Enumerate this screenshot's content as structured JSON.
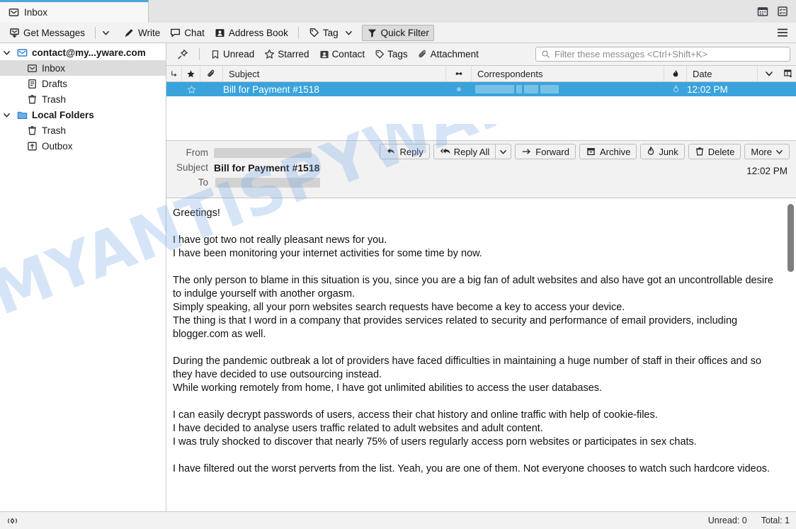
{
  "window": {
    "tab_label": "Inbox",
    "tab_icon": "inbox-mail-icon",
    "top_right_icons": [
      "calendar-icon",
      "tasks-icon"
    ],
    "app_menu_icon": "hamburger-menu-icon"
  },
  "toolbar": {
    "get_messages": "Get Messages",
    "get_messages_icon": "download-mail-icon",
    "write": "Write",
    "write_icon": "pencil-icon",
    "chat": "Chat",
    "chat_icon": "speech-bubble-icon",
    "address_book": "Address Book",
    "address_book_icon": "contact-card-icon",
    "tag": "Tag",
    "tag_icon": "tag-icon",
    "quick_filter": "Quick Filter",
    "quick_filter_icon": "funnel-icon",
    "quick_filter_active": true
  },
  "sidebar": {
    "accounts": [
      {
        "label": "contact@my...yware.com",
        "icon": "account-mail-icon",
        "expanded": true,
        "children": [
          {
            "label": "Inbox",
            "icon": "inbox-icon",
            "selected": true
          },
          {
            "label": "Drafts",
            "icon": "drafts-icon",
            "selected": false
          },
          {
            "label": "Trash",
            "icon": "trash-icon",
            "selected": false
          }
        ]
      },
      {
        "label": "Local Folders",
        "icon": "folder-icon",
        "expanded": true,
        "children": [
          {
            "label": "Trash",
            "icon": "trash-icon",
            "selected": false
          },
          {
            "label": "Outbox",
            "icon": "outbox-icon",
            "selected": false
          }
        ]
      }
    ]
  },
  "quick_filter": {
    "pin_icon": "pin-icon",
    "unread": "Unread",
    "unread_icon": "bookmark-icon",
    "starred": "Starred",
    "starred_icon": "star-icon",
    "contact": "Contact",
    "contact_icon": "contact-card-icon",
    "tags": "Tags",
    "tags_icon": "tag-icon",
    "attachment": "Attachment",
    "attachment_icon": "paperclip-icon",
    "search_placeholder": "Filter these messages <Ctrl+Shift+K>",
    "search_value": "",
    "search_icon": "magnifier-icon"
  },
  "message_list": {
    "columns": [
      {
        "label": "",
        "icon": "thread-icon"
      },
      {
        "label": "",
        "icon": "star-icon"
      },
      {
        "label": "",
        "icon": "paperclip-icon"
      },
      {
        "label": "Subject",
        "icon": ""
      },
      {
        "label": "",
        "icon": "unread-dot-icon"
      },
      {
        "label": "Correspondents",
        "icon": ""
      },
      {
        "label": "",
        "icon": "junk-icon"
      },
      {
        "label": "Date",
        "icon": ""
      },
      {
        "label": "",
        "icon": "sort-caret-icon"
      },
      {
        "label": "",
        "icon": "column-picker-icon"
      }
    ],
    "rows": [
      {
        "subject": "Bill for Payment #1518",
        "correspondents": "",
        "date": "12:02 PM",
        "selected": true,
        "starred": false
      }
    ]
  },
  "message_header": {
    "from_label": "From",
    "from_value": "",
    "subject_label": "Subject",
    "subject_value": "Bill for Payment #1518",
    "to_label": "To",
    "to_value": "",
    "time": "12:02 PM",
    "actions": [
      {
        "label": "Reply",
        "icon": "reply-icon"
      },
      {
        "label": "Reply All",
        "icon": "reply-all-icon",
        "has_caret": true
      },
      {
        "label": "Forward",
        "icon": "forward-arrow-icon"
      },
      {
        "label": "Archive",
        "icon": "archive-box-icon"
      },
      {
        "label": "Junk",
        "icon": "junk-flame-icon"
      },
      {
        "label": "Delete",
        "icon": "trash-icon"
      },
      {
        "label": "More",
        "icon": "",
        "has_caret": true
      }
    ]
  },
  "message_body": {
    "paragraphs": [
      "Greetings!",
      "I have got two not really pleasant news for you.\nI have been monitoring your internet activities for some time by now.",
      "The only person to blame in this situation is you, since you are a big fan of adult websites and also have got an uncontrollable desire to indulge yourself with another orgasm.\nSimply speaking, all your porn websites search requests have become a key to access your device.\nThe thing is that I word in a company that provides services related to security and performance of email providers, including blogger.com as well.",
      "During the pandemic outbreak a lot of providers have faced difficulties in maintaining a huge number of staff in their offices and so they have decided to use outsourcing instead.\nWhile working remotely from home, I have got unlimited abilities to access the user databases.",
      "I can easily decrypt passwords of users, access their chat history and online traffic with help of cookie-files.\nI have decided to analyse users traffic related to adult websites and adult content.\nI was truly shocked to discover that nearly 75% of users regularly access porn websites or participates in sex chats.",
      "I have filtered out the worst perverts from the list. Yeah, you are one of them. Not everyone chooses to watch such hardcore videos."
    ]
  },
  "status_bar": {
    "connection_icon": "connection-icon",
    "unread": "Unread: 0",
    "total": "Total: 1"
  },
  "watermark": {
    "text": "MYANTISPYWARE.COM"
  },
  "colors": {
    "selection_blue": "#3aa3dc",
    "tab_accent": "#4aa8d8",
    "chrome_gray": "#f2f2f2",
    "watermark_blue": "#78a5e6"
  }
}
